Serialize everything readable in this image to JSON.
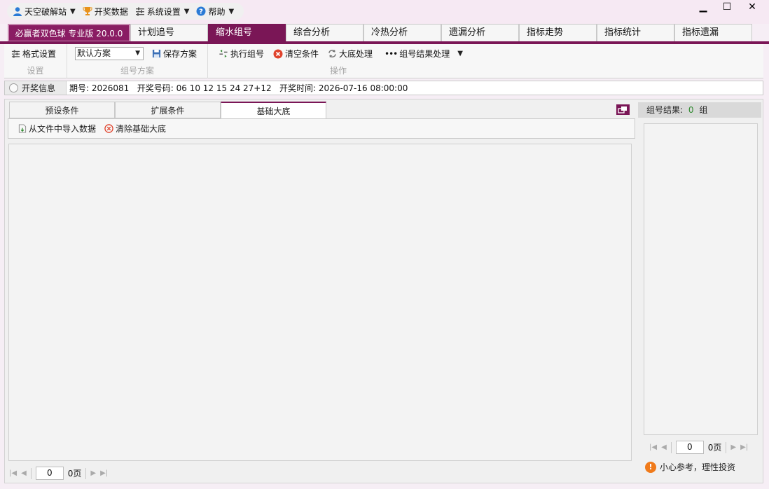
{
  "quickmenu": {
    "items": [
      {
        "label": "天空破解站",
        "icon": "user-icon",
        "has_menu": true
      },
      {
        "label": "开奖数据",
        "icon": "trophy-icon",
        "has_menu": false
      },
      {
        "label": "系统设置",
        "icon": "sliders-icon",
        "has_menu": true
      },
      {
        "label": "帮助",
        "icon": "help-icon",
        "has_menu": true
      }
    ]
  },
  "window": {
    "minimize": "▁",
    "maximize": "☐",
    "close": "✕"
  },
  "tabs": {
    "brand": "必赢者双色球 专业版 20.0.0",
    "items": [
      "计划追号",
      "缩水组号",
      "综合分析",
      "冷热分析",
      "遗漏分析",
      "指标走势",
      "指标统计",
      "指标遗漏"
    ],
    "active": "缩水组号"
  },
  "ribbon": {
    "format_settings": "格式设置",
    "group_settings": "设置",
    "scheme_select": "默认方案",
    "save_scheme": "保存方案",
    "group_scheme": "组号方案",
    "execute": "执行组号",
    "clear": "清空条件",
    "base_process": "大底处理",
    "result_process": "组号结果处理",
    "group_operation": "操作"
  },
  "info": {
    "header": "开奖信息",
    "text": "期号: 2026081   开奖号码: 06 10 12 15 24 27+12   开奖时间: 2026-07-16 08:00:00"
  },
  "subtabs": {
    "items": [
      "预设条件",
      "扩展条件",
      "基础大底"
    ],
    "active": "基础大底"
  },
  "subtoolbar": {
    "import": "从文件中导入数据",
    "clear_base": "清除基础大底"
  },
  "pager_main": {
    "page": "0",
    "page_suffix": "0页"
  },
  "result_panel": {
    "label": "组号结果:",
    "count": "0",
    "unit": "组",
    "pager_page": "0",
    "pager_suffix": "0页",
    "tip": "小心参考，理性投资"
  },
  "colors": {
    "brand": "#7a1656",
    "count_green": "#2f8a2f",
    "tip_orange": "#f07a1a"
  }
}
